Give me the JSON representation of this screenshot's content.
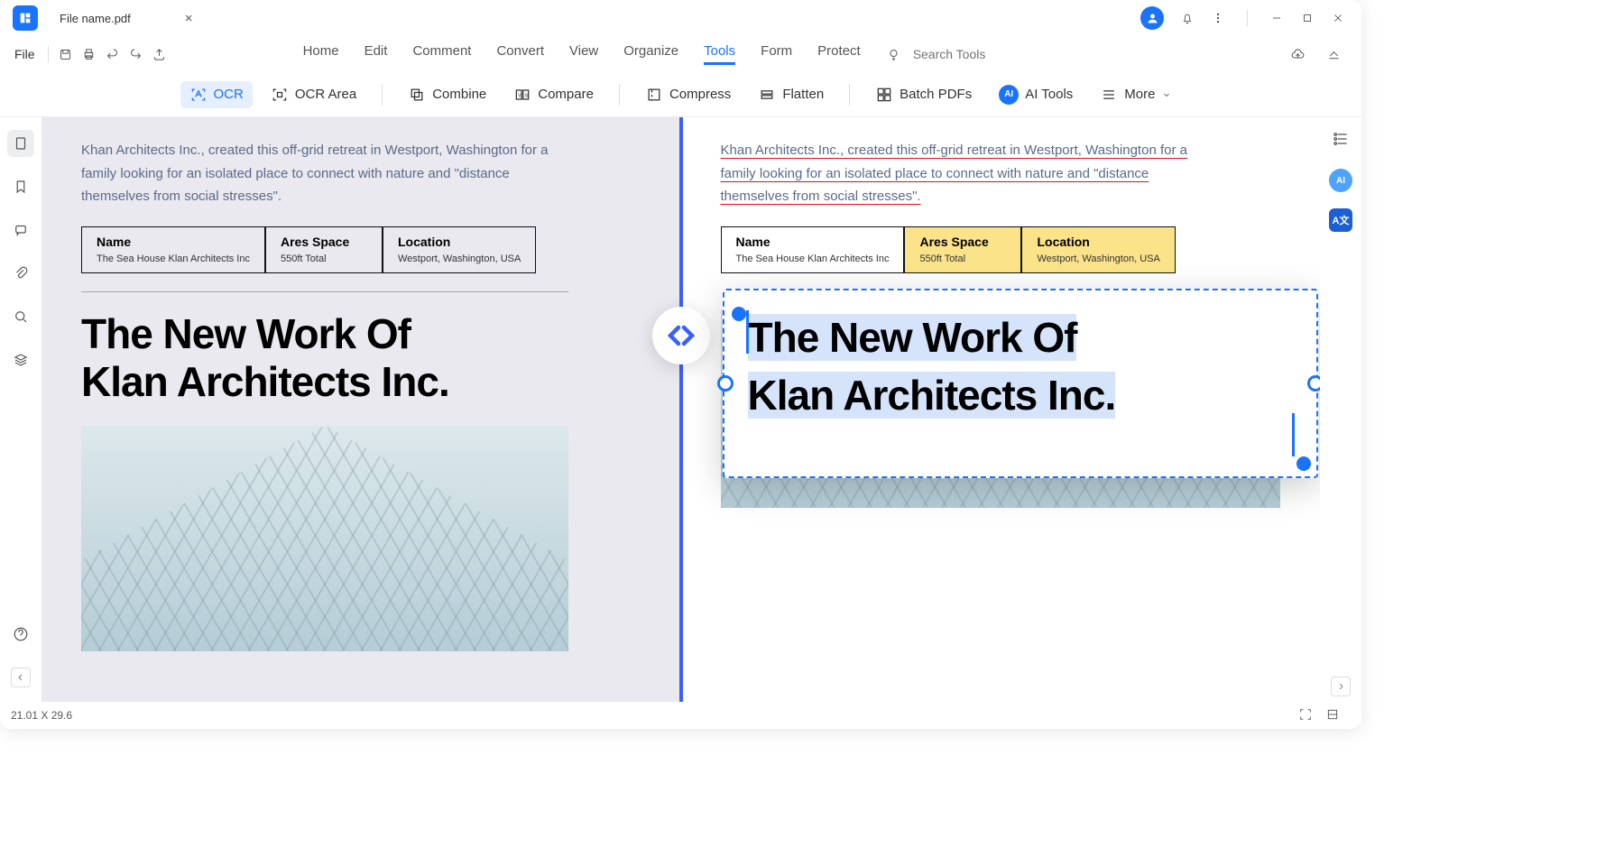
{
  "titlebar": {
    "filename": "File name.pdf"
  },
  "topbar": {
    "file": "File"
  },
  "menu": {
    "items": [
      "Home",
      "Edit",
      "Comment",
      "Convert",
      "View",
      "Organize",
      "Tools",
      "Form",
      "Protect"
    ],
    "active": 6
  },
  "search": {
    "placeholder": "Search Tools"
  },
  "ribbon": {
    "ocr": "OCR",
    "ocr_area": "OCR Area",
    "combine": "Combine",
    "compare": "Compare",
    "compress": "Compress",
    "flatten": "Flatten",
    "batch": "Batch PDFs",
    "ai_tools": "AI Tools",
    "more": "More",
    "ai_badge": "AI"
  },
  "doc": {
    "intro": "Khan Architects Inc., created this off-grid retreat in Westport, Washington for a family looking for an isolated place to connect with nature and \"distance themselves from social stresses\".",
    "table": {
      "cols": [
        {
          "hdr": "Name",
          "val": "The Sea House Klan Architects Inc"
        },
        {
          "hdr": "Ares Space",
          "val": "550ft Total"
        },
        {
          "hdr": "Location",
          "val": "Westport, Washington, USA"
        }
      ]
    },
    "title_line1": "The New Work Of",
    "title_line2": "Klan Architects Inc."
  },
  "status": {
    "coords": "21.01 X 29.6"
  },
  "right_rail": {
    "ai": "AI",
    "at": "A文"
  }
}
